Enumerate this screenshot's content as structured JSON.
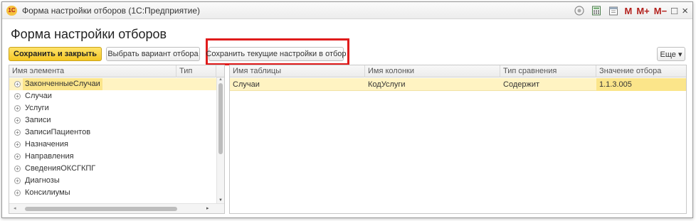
{
  "window": {
    "logo_text": "1С",
    "title": "Форма настройки отборов (1С:Предприятие)",
    "toolbar_icons": [
      "bell-icon",
      "calculator-icon",
      "calendar-icon"
    ],
    "mem_m": "M",
    "mem_mplus": "M+",
    "mem_mminus": "M−",
    "restore_symbol": "□",
    "close_symbol": "×"
  },
  "form": {
    "title": "Форма настройки отборов"
  },
  "toolbar": {
    "save_close_label": "Сохранить и закрыть",
    "choose_variant_label": "Выбрать вариант отбора",
    "save_current_label": "Сохранить текущие настройки в отбор",
    "more_label": "Еще ▾"
  },
  "left_panel": {
    "columns": [
      "Имя элемента",
      "Тип"
    ],
    "items": [
      "ЗаконченныеСлучаи",
      "Случаи",
      "Услуги",
      "Записи",
      "ЗаписиПациентов",
      "Назначения",
      "Направления",
      "СведенияОКСГКПГ",
      "Диагнозы",
      "Консилиумы"
    ],
    "selected_index": 0
  },
  "right_panel": {
    "columns": [
      "Имя таблицы",
      "Имя колонки",
      "Тип сравнения",
      "Значение отбора"
    ],
    "rows": [
      [
        "Случаи",
        "КодУслуги",
        "Содержит",
        "1.1.3.005"
      ]
    ]
  },
  "colors": {
    "accent_yellow": "#f5c825",
    "selection": "#fff3c2",
    "highlight_red": "#e01b1b"
  }
}
